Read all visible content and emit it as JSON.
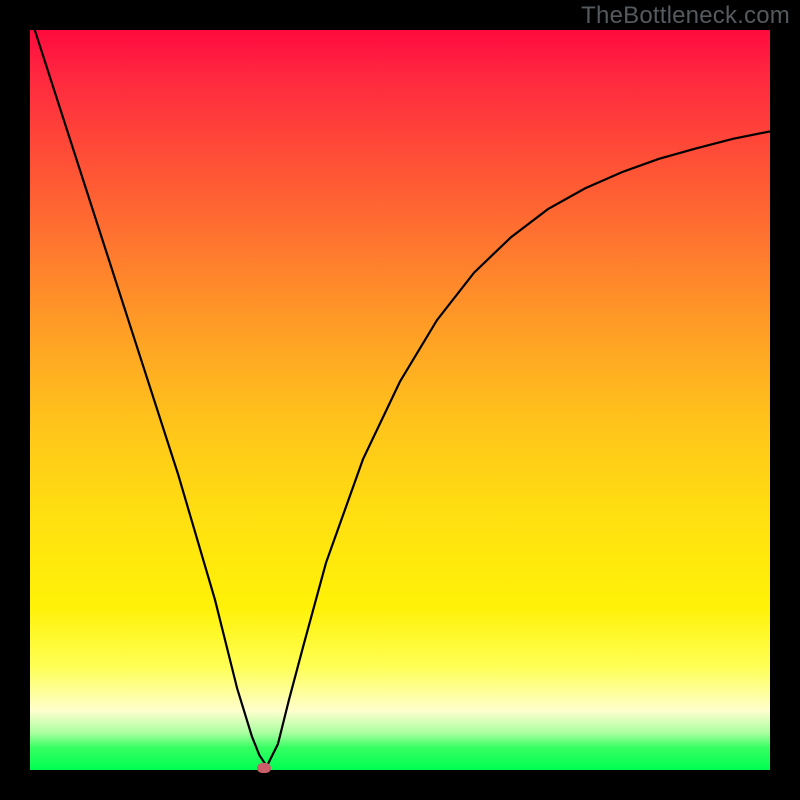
{
  "watermark": "TheBottleneck.com",
  "chart_data": {
    "type": "line",
    "title": "",
    "xlabel": "",
    "ylabel": "",
    "xlim": [
      0,
      1
    ],
    "ylim": [
      0,
      1
    ],
    "series": [
      {
        "name": "curve",
        "x": [
          0.0,
          0.05,
          0.1,
          0.15,
          0.2,
          0.25,
          0.28,
          0.3,
          0.31,
          0.32,
          0.335,
          0.35,
          0.37,
          0.4,
          0.45,
          0.5,
          0.55,
          0.6,
          0.65,
          0.7,
          0.75,
          0.8,
          0.85,
          0.9,
          0.95,
          1.0
        ],
        "y": [
          1.02,
          0.865,
          0.71,
          0.555,
          0.4,
          0.23,
          0.11,
          0.045,
          0.02,
          0.005,
          0.035,
          0.095,
          0.17,
          0.28,
          0.42,
          0.525,
          0.608,
          0.672,
          0.72,
          0.758,
          0.786,
          0.808,
          0.826,
          0.84,
          0.853,
          0.863
        ]
      }
    ],
    "marker": {
      "x": 0.316,
      "y": 0.003
    },
    "colors": {
      "curve": "#000000",
      "marker": "#cc5d6b",
      "gradient_top": "#ff0a3e",
      "gradient_bottom": "#00ff52"
    }
  }
}
